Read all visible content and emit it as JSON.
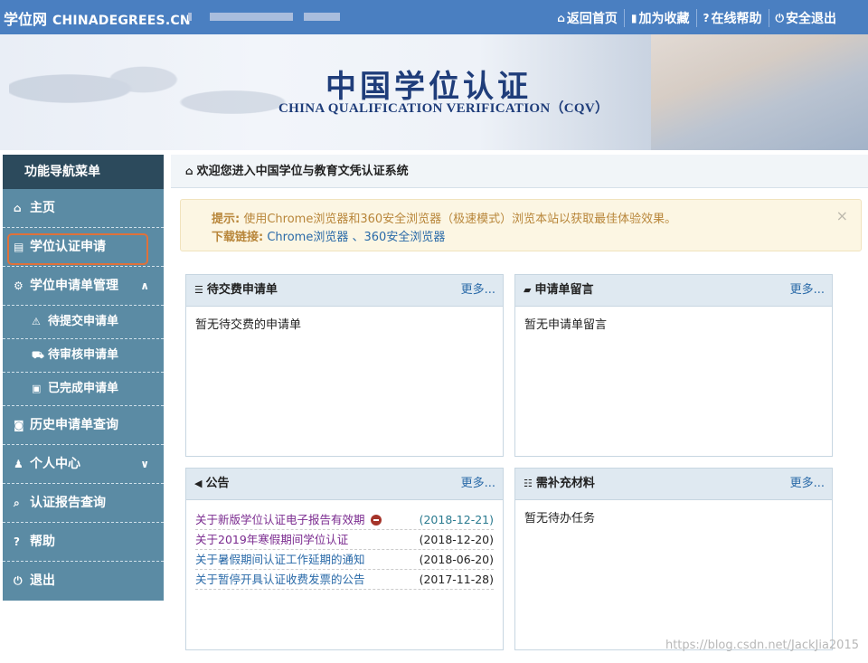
{
  "topbar": {
    "brand_cn": "学位网",
    "brand_en": "CHINADEGREES.CN",
    "nav": [
      {
        "icon": "home-icon",
        "glyph": "⌂",
        "label": "返回首页"
      },
      {
        "icon": "bookmark-icon",
        "glyph": "▮",
        "label": "加为收藏"
      },
      {
        "icon": "help-icon",
        "glyph": "?",
        "label": "在线帮助"
      },
      {
        "icon": "power-icon",
        "glyph": "⏻",
        "label": "安全退出"
      }
    ]
  },
  "banner": {
    "title": "中国学位认证",
    "subtitle": "CHINA QUALIFICATION VERIFICATION（CQV）"
  },
  "sidebar": {
    "header": "功能导航菜单",
    "items": [
      {
        "icon": "home-icon",
        "glyph": "⌂",
        "label": "主页"
      },
      {
        "icon": "file-icon",
        "glyph": "▤",
        "label": "学位认证申请"
      },
      {
        "icon": "gear-icon",
        "glyph": "⚙",
        "label": "学位申请单管理",
        "chevron": "∧"
      },
      {
        "icon": "warning-icon",
        "glyph": "⚠",
        "label": "待提交申请单"
      },
      {
        "icon": "cart-icon",
        "glyph": "⛟",
        "label": "待审核申请单"
      },
      {
        "icon": "briefcase-icon",
        "glyph": "▣",
        "label": "已完成申请单"
      },
      {
        "icon": "camera-icon",
        "glyph": "◙",
        "label": "历史申请单查询"
      },
      {
        "icon": "user-icon",
        "glyph": "♟",
        "label": "个人中心",
        "chevron": "∨"
      },
      {
        "icon": "search-icon",
        "glyph": "⌕",
        "label": "认证报告查询"
      },
      {
        "icon": "help-icon",
        "glyph": "?",
        "label": "帮助"
      },
      {
        "icon": "power-icon",
        "glyph": "⏻",
        "label": "退出"
      }
    ]
  },
  "main": {
    "header": "欢迎您进入中国学位与教育文凭认证系统",
    "alert": {
      "tip_label": "提示:",
      "tip_text": "使用Chrome浏览器和360安全浏览器（极速模式）浏览本站以获取最佳体验效果。",
      "download_label": "下载链接:",
      "link1": "Chrome浏览器",
      "sep": "、",
      "link2": "360安全浏览器",
      "close": "×"
    },
    "panels": {
      "pending_payment": {
        "title": "待交费申请单",
        "more": "更多...",
        "empty": "暂无待交费的申请单"
      },
      "messages": {
        "title": "申请单留言",
        "more": "更多...",
        "empty": "暂无申请单留言"
      },
      "announcements": {
        "title": "公告",
        "more": "更多...",
        "items": [
          {
            "title": "关于新版学位认证电子报告有效期",
            "date": "(2018-12-21)",
            "color": "#7a2a8f",
            "date_color": "#2a7a8f",
            "badge": true
          },
          {
            "title": "关于2019年寒假期间学位认证",
            "date": "(2018-12-20)",
            "color": "#7a2a8f",
            "date_color": "#222222",
            "badge": false
          },
          {
            "title": "关于暑假期间认证工作延期的通知",
            "date": "(2018-06-20)",
            "color": "#2a6aa8",
            "date_color": "#222222",
            "badge": false
          },
          {
            "title": "关于暂停开具认证收费发票的公告",
            "date": "(2017-11-28)",
            "color": "#2a6aa8",
            "date_color": "#222222",
            "badge": false
          }
        ]
      },
      "supplement": {
        "title": "需补充材料",
        "more": "更多...",
        "empty": "暂无待办任务"
      }
    }
  },
  "watermark": "https://blog.csdn.net/JackJia2015"
}
